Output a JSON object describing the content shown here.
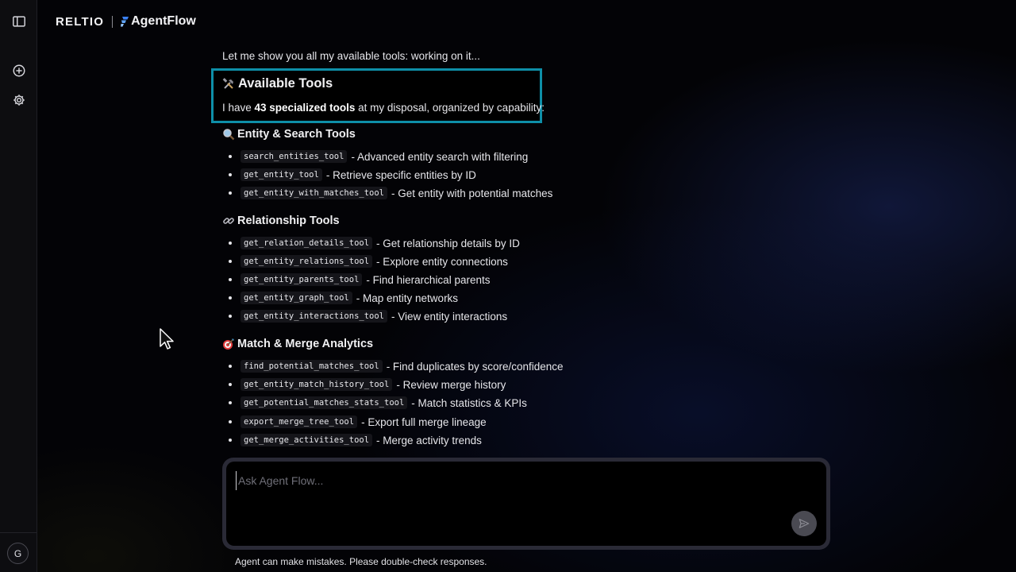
{
  "brand": {
    "company": "RELTIO",
    "product": "AgentFlow"
  },
  "sidebar": {
    "toggle_icon": "sidebar-toggle-icon",
    "new_chat_icon": "plus-circle-icon",
    "settings_icon": "gear-icon",
    "avatar_initial": "G"
  },
  "chat": {
    "intro": "Let me show you all my available tools: working on it...",
    "tools_title": "Available Tools",
    "tools_desc_prefix": "I have ",
    "tools_desc_bold": "43 specialized tools",
    "tools_desc_suffix": " at my disposal, organized by capability:",
    "sections": [
      {
        "title": "Entity & Search Tools",
        "icon": "magnifier-icon",
        "items": [
          {
            "code": "search_entities_tool",
            "desc": "- Advanced entity search with filtering"
          },
          {
            "code": "get_entity_tool",
            "desc": "- Retrieve specific entities by ID"
          },
          {
            "code": "get_entity_with_matches_tool",
            "desc": "- Get entity with potential matches"
          }
        ]
      },
      {
        "title": "Relationship Tools",
        "icon": "link-icon",
        "items": [
          {
            "code": "get_relation_details_tool",
            "desc": "- Get relationship details by ID"
          },
          {
            "code": "get_entity_relations_tool",
            "desc": "- Explore entity connections"
          },
          {
            "code": "get_entity_parents_tool",
            "desc": "- Find hierarchical parents"
          },
          {
            "code": "get_entity_graph_tool",
            "desc": "- Map entity networks"
          },
          {
            "code": "get_entity_interactions_tool",
            "desc": "- View entity interactions"
          }
        ]
      },
      {
        "title": "Match & Merge Analytics",
        "icon": "target-icon",
        "items": [
          {
            "code": "find_potential_matches_tool",
            "desc": "- Find duplicates by score/confidence"
          },
          {
            "code": "get_entity_match_history_tool",
            "desc": "- Review merge history"
          },
          {
            "code": "get_potential_matches_stats_tool",
            "desc": "- Match statistics & KPIs"
          },
          {
            "code": "export_merge_tree_tool",
            "desc": "- Export full merge lineage"
          },
          {
            "code": "get_merge_activities_tool",
            "desc": "- Merge activity trends"
          }
        ]
      }
    ]
  },
  "input": {
    "placeholder": "Ask Agent Flow...",
    "value": ""
  },
  "disclaimer": "Agent can make mistakes. Please double-check responses.",
  "colors": {
    "accent_box": "#0e8fa8",
    "send_button": "#4a4a52",
    "input_border": "#2a2a36"
  }
}
